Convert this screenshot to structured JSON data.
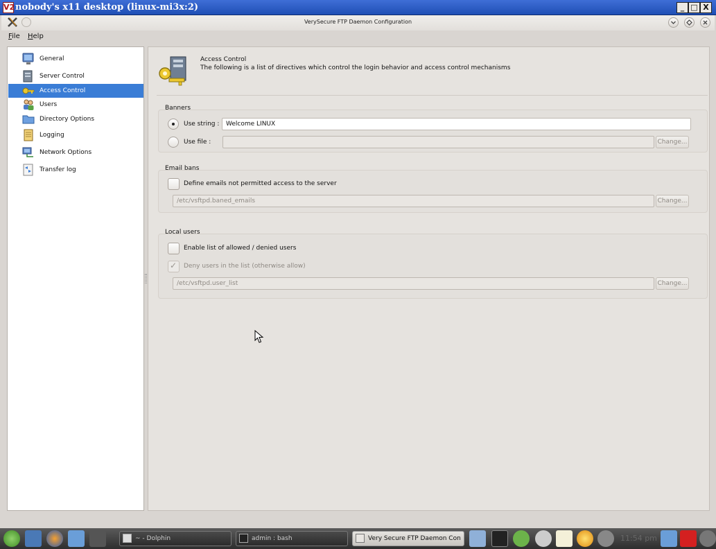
{
  "vnc": {
    "logo": "V2",
    "title": "nobody's x11 desktop (linux-mi3x:2)",
    "buttons": {
      "minimize": "_",
      "maximize": "□",
      "close": "X"
    }
  },
  "app": {
    "title": "VerySecure FTP Daemon Configuration",
    "icon": "vsftpd-x-icon"
  },
  "menu": {
    "file": "File",
    "help": "Help"
  },
  "sidebar": {
    "items": [
      {
        "label": "General",
        "icon": "monitor-icon",
        "selected": false
      },
      {
        "label": "Server Control",
        "icon": "server-icon",
        "selected": false
      },
      {
        "label": "Access Control",
        "icon": "key-icon",
        "selected": true
      },
      {
        "label": "Users",
        "icon": "users-icon",
        "selected": false
      },
      {
        "label": "Directory Options",
        "icon": "folder-icon",
        "selected": false
      },
      {
        "label": "Logging",
        "icon": "notebook-icon",
        "selected": false
      },
      {
        "label": "Network Options",
        "icon": "network-icon",
        "selected": false
      },
      {
        "label": "Transfer log",
        "icon": "transfer-log-icon",
        "selected": false
      }
    ]
  },
  "header": {
    "title": "Access Control",
    "description": "The following is a list of directives which control the login behavior and access control mechanisms"
  },
  "banners": {
    "group_title": "Banners",
    "use_string_label": "Use string :",
    "use_string_value": "Welcome LINUX",
    "use_string_checked": true,
    "use_file_label": "Use file :",
    "use_file_value": "",
    "change_label": "Change..."
  },
  "email_bans": {
    "group_title": "Email bans",
    "checkbox_label": "Define emails not permitted access to the server",
    "checked": false,
    "file_value": "/etc/vsftpd.baned_emails",
    "change_label": "Change..."
  },
  "local_users": {
    "group_title": "Local users",
    "enable_label": "Enable list of allowed / denied users",
    "enable_checked": false,
    "deny_label": "Deny users in the list (otherwise allow)",
    "deny_checked": true,
    "file_value": "/etc/vsftpd.user_list",
    "change_label": "Change..."
  },
  "taskbar": {
    "tasks": [
      {
        "label": "~ - Dolphin",
        "active": false
      },
      {
        "label": "admin : bash",
        "active": false
      },
      {
        "label": "Very Secure FTP Daemon Con",
        "active": true
      }
    ],
    "clock": "11:54 pm"
  },
  "colors": {
    "accent": "#3a7dd6",
    "vnc_titlebar": "#2a5cc4",
    "taskbar": "#3a3a3a"
  }
}
